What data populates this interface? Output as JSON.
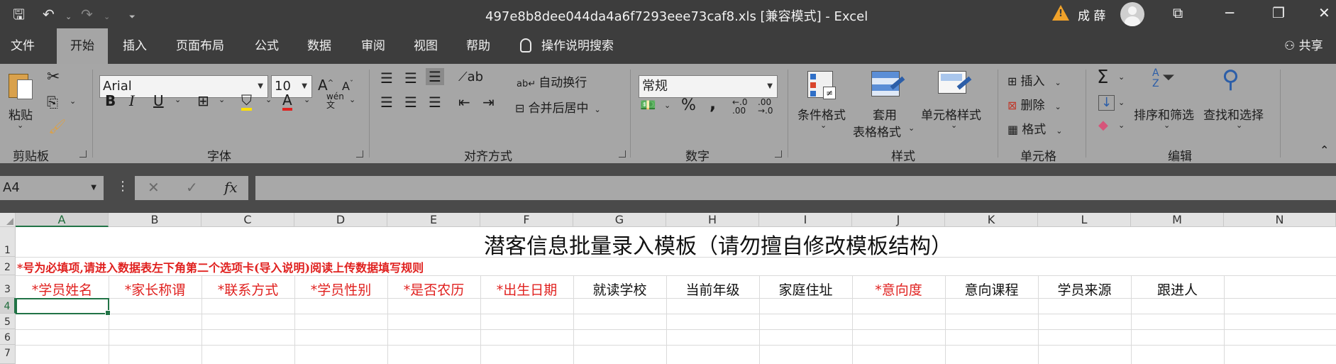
{
  "titlebar": {
    "doc_title": "497e8b8dee044da4a6f7293eee73caf8.xls  [兼容模式]  -  Excel",
    "user_name": "成 薛",
    "icons": [
      "save-icon",
      "undo-icon",
      "redo-icon",
      "customize-icon",
      "warning-icon",
      "avatar",
      "ribbon-display-icon",
      "minimize-icon",
      "restore-icon",
      "close-icon"
    ]
  },
  "tabs": [
    {
      "label": "文件"
    },
    {
      "label": "开始",
      "active": true
    },
    {
      "label": "插入"
    },
    {
      "label": "页面布局"
    },
    {
      "label": "公式"
    },
    {
      "label": "数据"
    },
    {
      "label": "审阅"
    },
    {
      "label": "视图"
    },
    {
      "label": "帮助"
    }
  ],
  "tell_me": "操作说明搜索",
  "share": "共享",
  "ribbon": {
    "clipboard": {
      "paste": "粘贴",
      "label": "剪贴板"
    },
    "font": {
      "name": "Arial",
      "size": "10",
      "bold": "B",
      "italic": "I",
      "underline": "U",
      "label": "字体"
    },
    "alignment": {
      "wrap": "自动换行",
      "merge": "合并后居中",
      "label": "对齐方式"
    },
    "number": {
      "format": "常规",
      "percent": "%",
      "comma": ",",
      "label": "数字"
    },
    "styles": {
      "conditional": "条件格式",
      "table_line1": "套用",
      "table_line2": "表格格式",
      "cell_styles": "单元格样式",
      "label": "样式"
    },
    "cells": {
      "insert": "插入",
      "delete": "删除",
      "format": "格式",
      "label": "单元格"
    },
    "editing": {
      "sort": "排序和筛选",
      "find": "查找和选择",
      "label": "编辑"
    }
  },
  "formula_bar": {
    "name_box": "A4",
    "fx": "fx",
    "value": ""
  },
  "sheet": {
    "columns": [
      "A",
      "B",
      "C",
      "D",
      "E",
      "F",
      "G",
      "H",
      "I",
      "J",
      "K",
      "L",
      "M",
      "N"
    ],
    "rows": [
      "1",
      "2",
      "3",
      "4",
      "5",
      "6",
      "7"
    ],
    "title": "潜客信息批量录入模板（请勿擅自修改模板结构）",
    "note": "*号为必填项,请进入数据表左下角第二个选项卡(导入说明)阅读上传数据填写规则",
    "headers": [
      {
        "text": "*学员姓名",
        "required": true
      },
      {
        "text": "*家长称谓",
        "required": true
      },
      {
        "text": "*联系方式",
        "required": true
      },
      {
        "text": "*学员性别",
        "required": true
      },
      {
        "text": "*是否农历",
        "required": true
      },
      {
        "text": "*出生日期",
        "required": true
      },
      {
        "text": "就读学校",
        "required": false
      },
      {
        "text": "当前年级",
        "required": false
      },
      {
        "text": "家庭住址",
        "required": false
      },
      {
        "text": "*意向度",
        "required": true
      },
      {
        "text": "意向课程",
        "required": false
      },
      {
        "text": "学员来源",
        "required": false
      },
      {
        "text": "跟进人",
        "required": false
      }
    ],
    "selected_cell": "A4",
    "required_color": "#e0211f",
    "accent": "#217346"
  }
}
